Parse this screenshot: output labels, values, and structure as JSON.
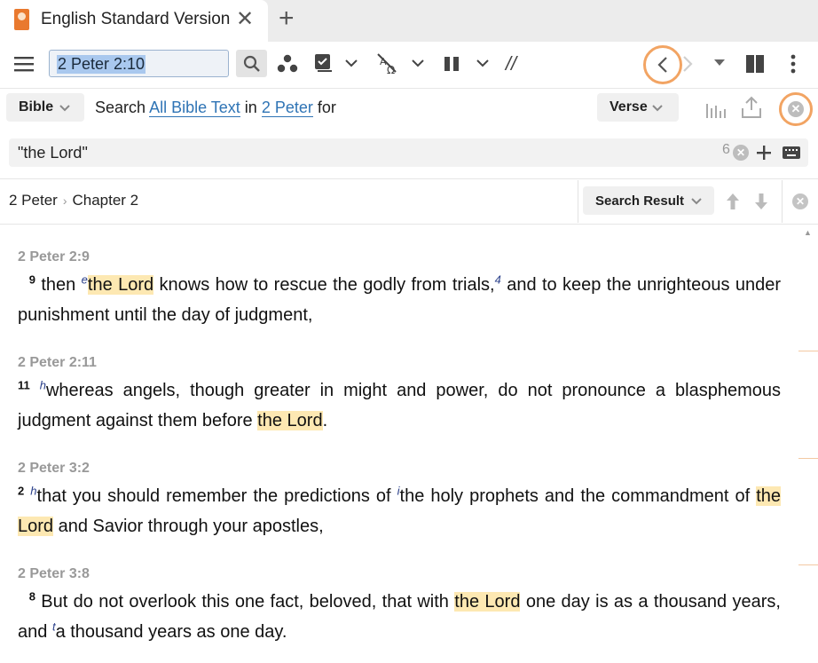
{
  "tab": {
    "title": "English Standard Version",
    "close": "✕",
    "add": "+"
  },
  "toolbar": {
    "reference_value": "2 Peter 2:10",
    "separator_glyph": "//",
    "icons": [
      "menu-icon",
      "search-icon",
      "visual-filters-icon",
      "checklist-icon",
      "interlinear-icon",
      "parallel-icon",
      "text-comparison-icon",
      "back-icon",
      "forward-icon",
      "layout-icon",
      "more-icon"
    ]
  },
  "search": {
    "scope_label": "Bible",
    "prefix": "Search",
    "text_scope": "All Bible Text",
    "in": "in",
    "range": "2 Peter",
    "for": "for",
    "view_label": "Verse",
    "query": "\"the Lord\"",
    "result_count": "6"
  },
  "nav": {
    "book": "2 Peter",
    "chapter": "Chapter 2",
    "mode_label": "Search Result"
  },
  "results": [
    {
      "ref": "2 Peter 2:9",
      "num": "9",
      "footnote": "e",
      "pre": " then ",
      "hl": "the Lord",
      "mid": " knows how to rescue the godly from trials,",
      "footnote2": "4",
      "post": " and to keep the unrighteous under punishment until the day of judgment,"
    },
    {
      "ref": "2 Peter 2:11",
      "num": "11",
      "footnote": "h",
      "pre": "whereas angels, though greater in might and power, do not pronounce a blasphemous judgment against them before ",
      "hl": "the Lord",
      "post": "."
    },
    {
      "ref": "2 Peter 3:2",
      "num": "2",
      "footnote": "h",
      "footnote2": "i",
      "pre": "that you should remember the predictions of ",
      "mid": "the holy prophets and the commandment of ",
      "hl": "the Lord",
      "post": " and Savior through your apostles,"
    },
    {
      "ref": "2 Peter 3:8",
      "num": "8",
      "pre": " But do not overlook this one fact, beloved, that with ",
      "hl": "the Lord",
      "mid": " one day is as a thousand years, and ",
      "footnote2": "t",
      "post": "a thousand years as one day."
    }
  ],
  "colors": {
    "accent_orange": "#f2a463",
    "link_blue": "#2f74b5",
    "highlight": "#fde8b2"
  }
}
